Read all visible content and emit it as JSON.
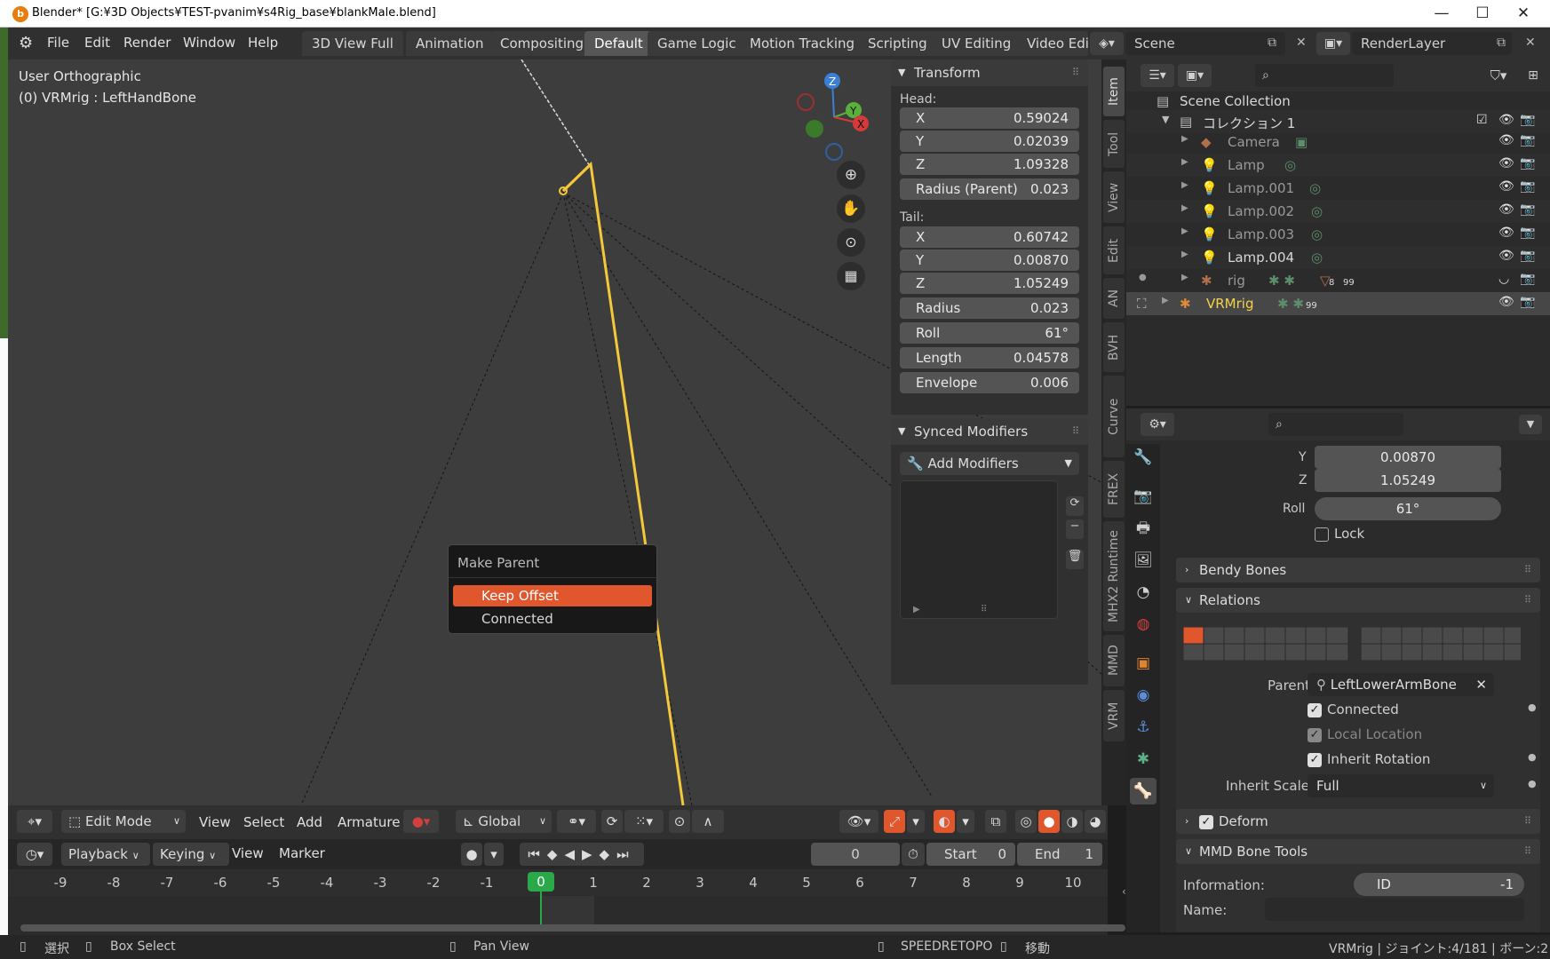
{
  "window": {
    "title": "Blender* [G:¥3D Objects¥TEST-pvanim¥s4Rig_base¥blankMale.blend]",
    "controls": [
      "—",
      "☐",
      "✕"
    ]
  },
  "menu": [
    "File",
    "Edit",
    "Render",
    "Window",
    "Help"
  ],
  "workspaces": [
    "3D View Full",
    "Animation",
    "Compositing",
    "Default",
    "Game Logic",
    "Motion Tracking",
    "Scripting",
    "UV Editing",
    "Video Edit"
  ],
  "active_workspace": "Default",
  "scene": {
    "name": "Scene",
    "render_layer": "RenderLayer"
  },
  "viewport": {
    "view_name": "User Orthographic",
    "object_info": "(0) VRMrig : LeftHandBone",
    "gizmo": {
      "x": "X",
      "y": "Y",
      "z": "Z"
    }
  },
  "transform": {
    "title": "Transform",
    "head_label": "Head:",
    "head": [
      {
        "k": "X",
        "v": "0.59024"
      },
      {
        "k": "Y",
        "v": "0.02039"
      },
      {
        "k": "Z",
        "v": "1.09328"
      },
      {
        "k": "Radius (Parent)",
        "v": "0.023"
      }
    ],
    "tail_label": "Tail:",
    "tail": [
      {
        "k": "X",
        "v": "0.60742"
      },
      {
        "k": "Y",
        "v": "0.00870"
      },
      {
        "k": "Z",
        "v": "1.05249"
      },
      {
        "k": "Radius",
        "v": "0.023"
      },
      {
        "k": "Roll",
        "v": "61°"
      },
      {
        "k": "Length",
        "v": "0.04578"
      },
      {
        "k": "Envelope",
        "v": "0.006"
      }
    ]
  },
  "synced_modifiers": {
    "title": "Synced Modifiers",
    "add_label": "Add Modifiers"
  },
  "side_tabs": [
    "Item",
    "Tool",
    "View",
    "Edit",
    "AN",
    "BVH",
    "Curve",
    "FREX",
    "MHX2 Runtime",
    "MMD",
    "VRM"
  ],
  "context_menu": {
    "title": "Make Parent",
    "items": [
      "Keep Offset",
      "Connected"
    ]
  },
  "outliner": {
    "root": "Scene Collection",
    "collection": "コレクション 1",
    "items": [
      {
        "name": "Camera",
        "color": "#a0a0a0"
      },
      {
        "name": "Lamp",
        "color": "#a0a0a0"
      },
      {
        "name": "Lamp.001",
        "color": "#a0a0a0"
      },
      {
        "name": "Lamp.002",
        "color": "#a0a0a0"
      },
      {
        "name": "Lamp.003",
        "color": "#a0a0a0"
      },
      {
        "name": "Lamp.004",
        "color": "#d8d8d8"
      },
      {
        "name": "rig",
        "color": "#a0a0a0"
      },
      {
        "name": "VRMrig",
        "color": "#f2d24b"
      }
    ],
    "badges": {
      "rig_a": "8",
      "rig_b": "99",
      "vrm": "99"
    }
  },
  "bone_props": {
    "y": {
      "k": "Y",
      "v": "0.00870"
    },
    "z": {
      "k": "Z",
      "v": "1.05249"
    },
    "roll": {
      "k": "Roll",
      "v": "61°"
    },
    "lock": "Lock",
    "bendy": "Bendy Bones",
    "relations": "Relations",
    "parent_label": "Parent",
    "parent": "LeftLowerArmBone",
    "connected": "Connected",
    "local_location": "Local Location",
    "inherit_rotation": "Inherit Rotation",
    "inherit_scale_label": "Inherit Scale",
    "inherit_scale": "Full",
    "deform": "Deform",
    "mmd": "MMD Bone Tools",
    "info_label": "Information:",
    "id_label": "ID",
    "id_value": "-1",
    "name_label": "Name:"
  },
  "header3d": {
    "mode": "Edit Mode",
    "menus": [
      "View",
      "Select",
      "Add",
      "Armature"
    ],
    "orientation": "Global"
  },
  "timeline": {
    "menus": [
      "Playback",
      "Keying",
      "View",
      "Marker"
    ],
    "current": "0",
    "start_label": "Start",
    "start": "0",
    "end_label": "End",
    "end": "1",
    "ticks": [
      "-9",
      "-8",
      "-7",
      "-6",
      "-5",
      "-4",
      "-3",
      "-2",
      "-1",
      "0",
      "1",
      "2",
      "3",
      "4",
      "5",
      "6",
      "7",
      "8",
      "9",
      "10"
    ],
    "playhead": "0"
  },
  "status": {
    "left1": "選択",
    "left2": "Box Select",
    "mid": "Pan View",
    "right1": "SPEEDRETOPO",
    "right2": "移動",
    "info": "VRMrig | ジョイント:4/181 | ボーン:2"
  },
  "colors": {
    "accent": "#e0572e",
    "bone": "#f5c83a",
    "playhead": "#2aa84a"
  }
}
